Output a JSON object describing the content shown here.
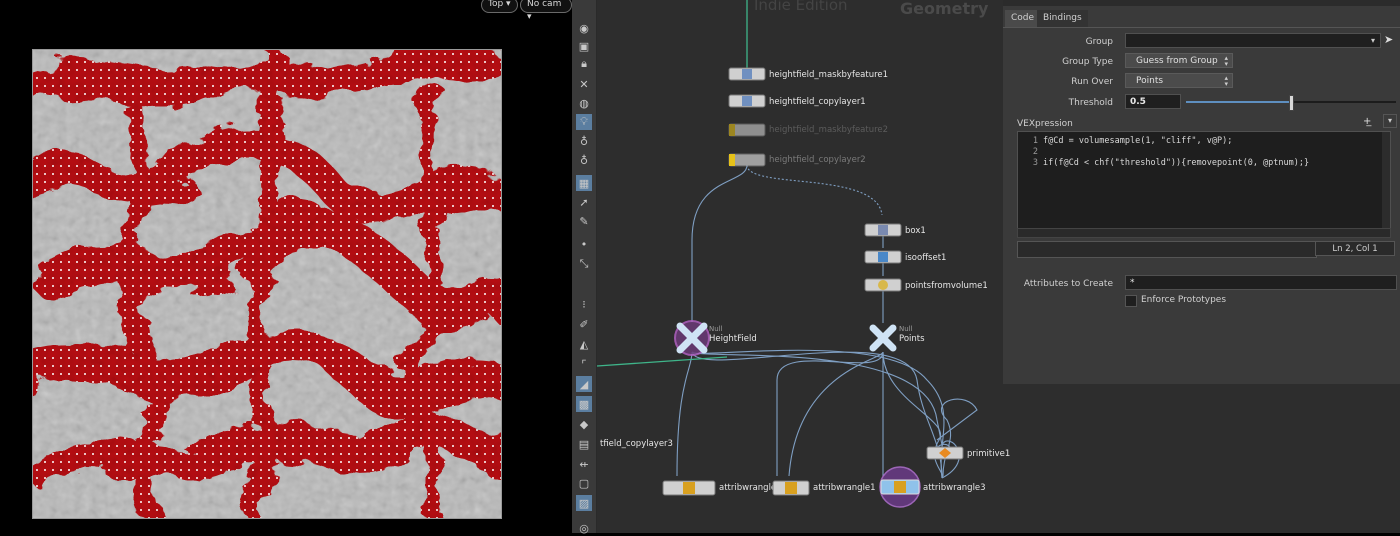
{
  "viewport": {
    "view_menu": "Top",
    "camera_menu": "No cam",
    "colors": {
      "background": "#000000",
      "terrain": "#b9b9b9",
      "mask": "#b80d12"
    }
  },
  "network": {
    "watermark_left": "Indie Edition",
    "watermark_right": "Geometry",
    "nodes": {
      "maskbyfeature1": "heightfield_maskbyfeature1",
      "copylayer1": "heightfield_copylayer1",
      "maskbyfeature2": "heightfield_maskbyfeature2",
      "copylayer2": "heightfield_copylayer2",
      "box1": "box1",
      "isooffset1": "isooffset1",
      "pointsfromvolume1": "pointsfromvolume1",
      "heightfield_null": "HeightField",
      "points_null": "Points",
      "null_tag": "Null",
      "copylayer3": "tfield_copylayer3",
      "attribwrangle2": "attribwrangle2",
      "attribwrangle1": "attribwrangle1",
      "attribwrangle3": "attribwrangle3",
      "primitive1": "primitive1"
    }
  },
  "params": {
    "tabs": [
      "Code",
      "Bindings"
    ],
    "group_label": "Group",
    "group_value": "",
    "group_type_label": "Group Type",
    "group_type_value": "Guess from Group",
    "run_over_label": "Run Over",
    "run_over_value": "Points",
    "threshold_label": "Threshold",
    "threshold_value": "0.5",
    "threshold_fraction": 0.5,
    "vexpression_label": "VEXpression",
    "code_lines": [
      "f@Cd = volumesample(1, \"cliff\", v@P);",
      "",
      "if(f@Cd < chf(\"threshold\")){removepoint(0, @ptnum);}"
    ],
    "line_numbers": [
      "1",
      "2",
      "3"
    ],
    "cursor_pos": "Ln 2, Col 1",
    "attributes_label": "Attributes to Create",
    "attributes_value": "*",
    "enforce_label": "Enforce Prototypes"
  }
}
